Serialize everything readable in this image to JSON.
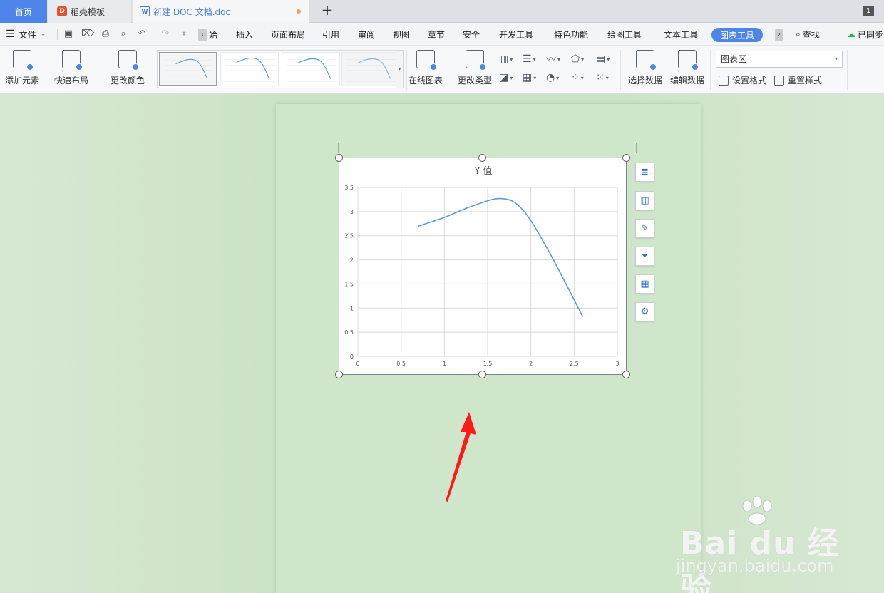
{
  "tabs": {
    "home": "首页",
    "template": "稻壳模板",
    "doc": "新建 DOC 文档.doc",
    "add": "+",
    "window_count": "1"
  },
  "menu": {
    "file": "文件",
    "items": [
      "始",
      "插入",
      "页面布局",
      "引用",
      "审阅",
      "视图",
      "章节",
      "安全",
      "开发工具",
      "特色功能",
      "绘图工具",
      "文本工具"
    ],
    "active": "图表工具",
    "search": "查找",
    "sync": "已同步"
  },
  "ribbon": {
    "add_element": "添加元素",
    "quick_layout": "快速布局",
    "change_color": "更改颜色",
    "online_chart": "在线图表",
    "change_type": "更改类型",
    "select_data": "选择数据",
    "edit_data": "编辑数据",
    "chart_area_select": "图表区",
    "set_format": "设置格式",
    "reset_style": "重置样式"
  },
  "chart_data": {
    "type": "line",
    "title": "Y 值",
    "xlabel": "",
    "ylabel": "",
    "xlim": [
      0,
      3
    ],
    "ylim": [
      0,
      3.5
    ],
    "x_ticks": [
      "0",
      "0.5",
      "1",
      "1.5",
      "2",
      "2.5",
      "3"
    ],
    "y_ticks": [
      "0",
      "0.5",
      "1",
      "1.5",
      "2",
      "2.5",
      "3",
      "3.5"
    ],
    "grid": true,
    "series": [
      {
        "color": "#5b9bd5",
        "smooth": true,
        "x": [
          0.7,
          1.0,
          1.3,
          1.65,
          1.9,
          2.2,
          2.6
        ],
        "y": [
          2.7,
          2.88,
          3.1,
          3.27,
          3.05,
          2.2,
          0.82
        ]
      }
    ]
  },
  "watermark": {
    "brand": "Bai du 经验",
    "url": "jingyan.baidu.com"
  },
  "colors": {
    "accent": "#4d86e8",
    "page_bg": "#cfe6cb",
    "arrow": "#ff1a1a"
  }
}
